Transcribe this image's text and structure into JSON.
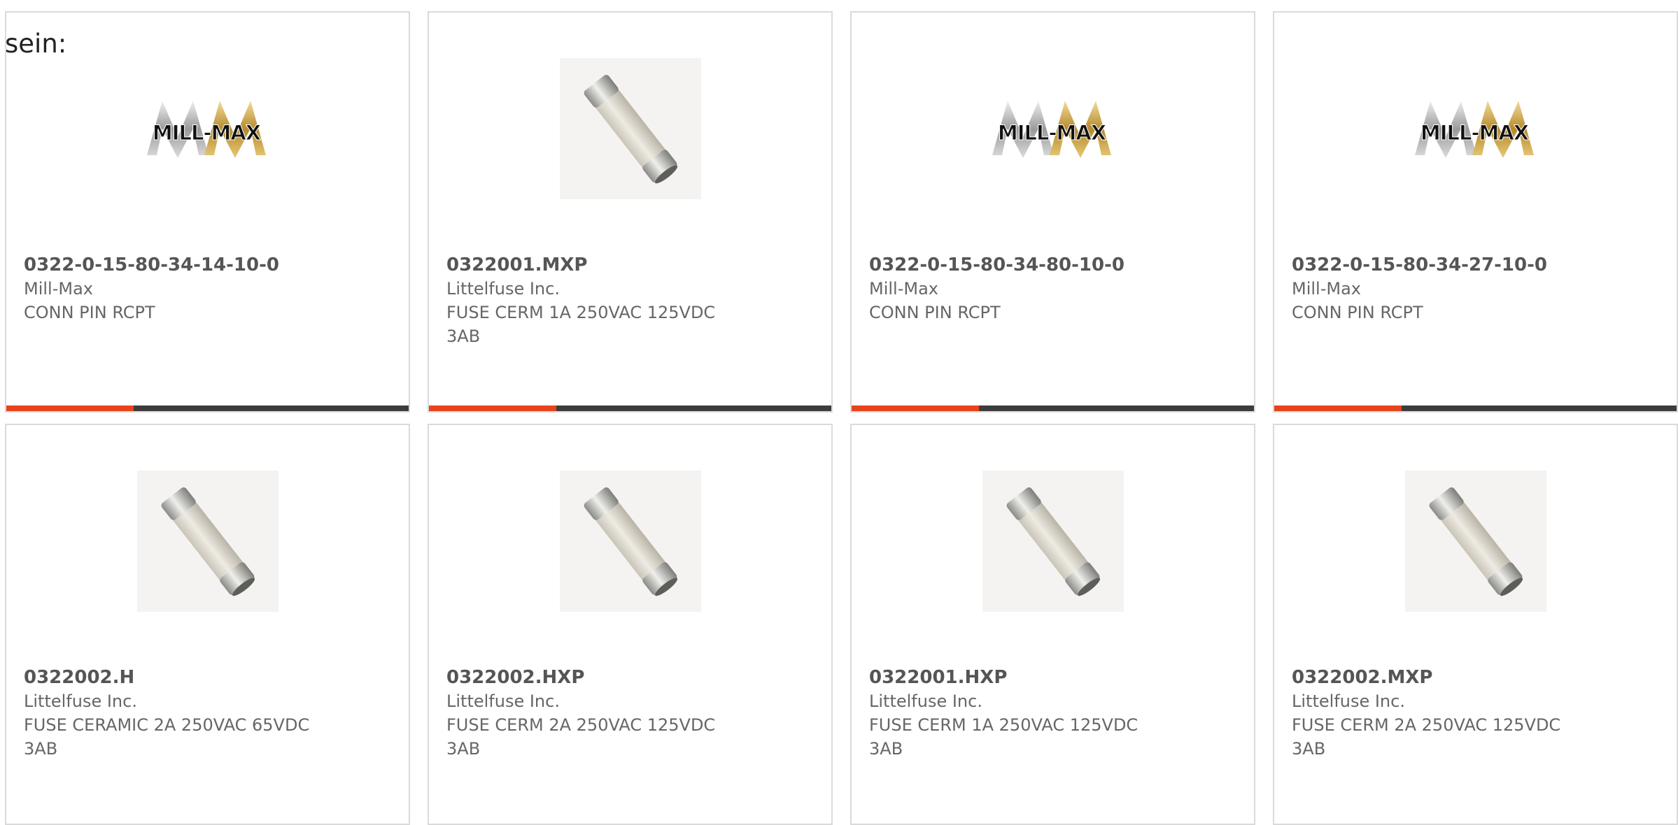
{
  "intro_text": "sein:",
  "colors": {
    "accent": "#e8431b",
    "bar_dark": "#3c3c3c",
    "card_border": "#dadada"
  },
  "products": [
    {
      "part": "0322-0-15-80-34-14-10-0",
      "manufacturer": "Mill-Max",
      "description": "CONN PIN RCPT",
      "image": "mill-max-logo",
      "image_text": "MILL-MAX",
      "show_bar": true
    },
    {
      "part": "0322001.MXP",
      "manufacturer": "Littelfuse Inc.",
      "description": "FUSE CERM 1A 250VAC 125VDC 3AB",
      "image": "ceramic-fuse",
      "show_bar": true
    },
    {
      "part": "0322-0-15-80-34-80-10-0",
      "manufacturer": "Mill-Max",
      "description": "CONN PIN RCPT",
      "image": "mill-max-logo",
      "image_text": "MILL-MAX",
      "show_bar": true
    },
    {
      "part": "0322-0-15-80-34-27-10-0",
      "manufacturer": "Mill-Max",
      "description": "CONN PIN RCPT",
      "image": "mill-max-logo",
      "image_text": "MILL-MAX",
      "show_bar": true
    },
    {
      "part": "0322002.H",
      "manufacturer": "Littelfuse Inc.",
      "description": "FUSE CERAMIC 2A 250VAC 65VDC 3AB",
      "image": "ceramic-fuse",
      "show_bar": false
    },
    {
      "part": "0322002.HXP",
      "manufacturer": "Littelfuse Inc.",
      "description": "FUSE CERM 2A 250VAC 125VDC 3AB",
      "image": "ceramic-fuse",
      "show_bar": false
    },
    {
      "part": "0322001.HXP",
      "manufacturer": "Littelfuse Inc.",
      "description": "FUSE CERM 1A 250VAC 125VDC 3AB",
      "image": "ceramic-fuse",
      "show_bar": false
    },
    {
      "part": "0322002.MXP",
      "manufacturer": "Littelfuse Inc.",
      "description": "FUSE CERM 2A 250VAC 125VDC 3AB",
      "image": "ceramic-fuse",
      "show_bar": false
    }
  ]
}
